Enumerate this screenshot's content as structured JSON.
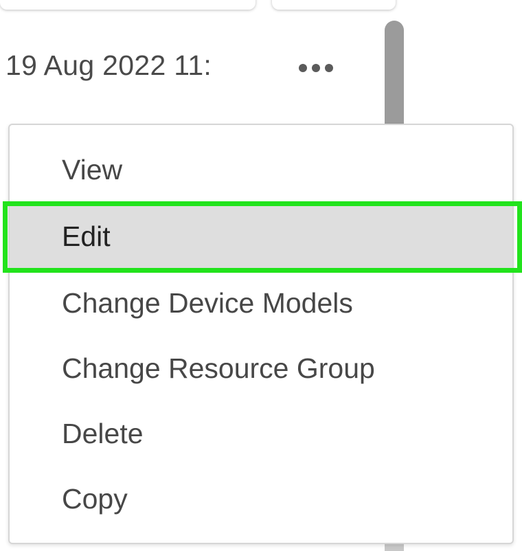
{
  "row": {
    "timestamp": "19 Aug 2022 11:",
    "more_icon": "more-horizontal-icon"
  },
  "context_menu": {
    "items": [
      {
        "label": "View",
        "highlighted": false
      },
      {
        "label": "Edit",
        "highlighted": true
      },
      {
        "label": "Change Device Models",
        "highlighted": false
      },
      {
        "label": "Change Resource Group",
        "highlighted": false
      },
      {
        "label": "Delete",
        "highlighted": false
      },
      {
        "label": "Copy",
        "highlighted": false
      }
    ]
  },
  "colors": {
    "highlight_outline": "#22e31c",
    "highlight_background": "#dedede",
    "menu_text": "#474747"
  }
}
